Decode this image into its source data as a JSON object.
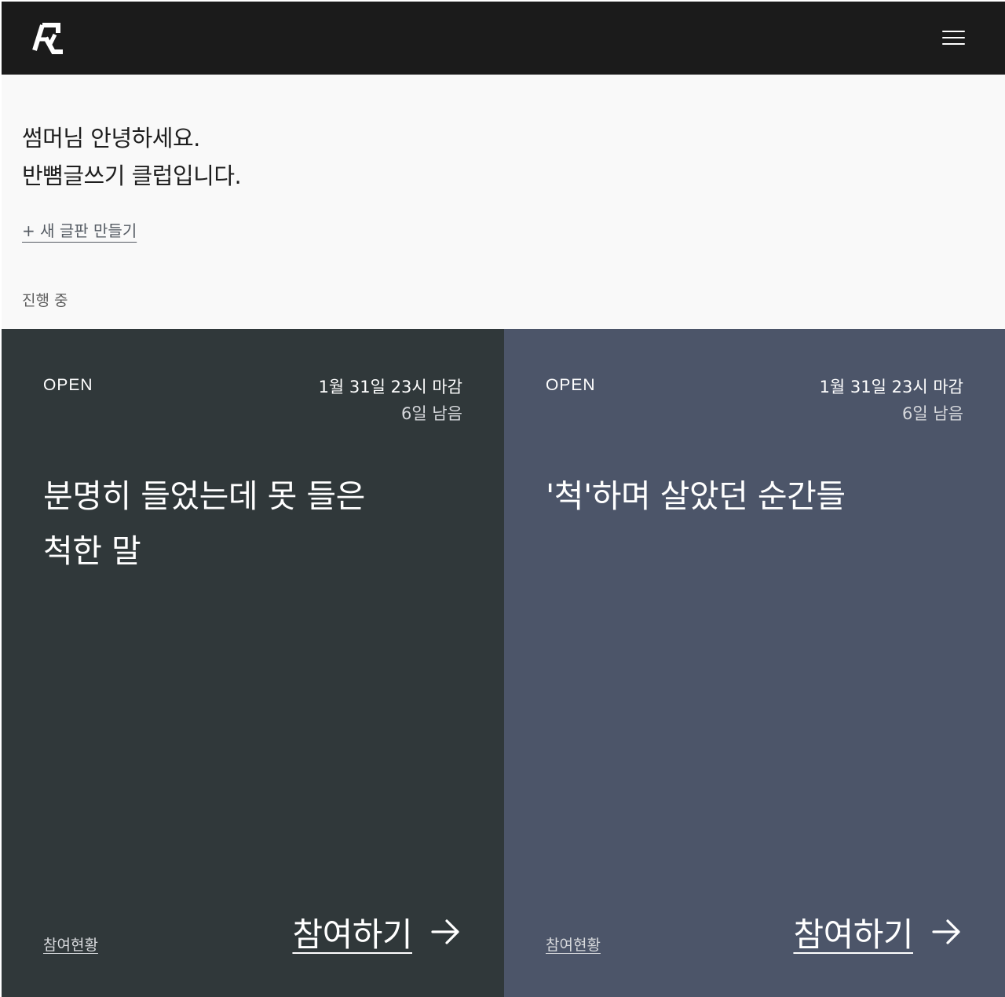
{
  "header": {
    "logo_icon": "brand-logo-icon",
    "menu_icon": "hamburger-menu-icon"
  },
  "greeting": {
    "line1": "썸머님 안녕하세요.",
    "line2": "반뼘글쓰기 클럽입니다."
  },
  "new_board_link": "+ 새 글판 만들기",
  "section_label": "진행 중",
  "cards": [
    {
      "status": "OPEN",
      "deadline": "1월 31일 23시 마감",
      "remaining": "6일 남음",
      "title_line1": "분명히 들었는데 못 들은",
      "title_line2": "척한 말",
      "participation_link": "참여현황",
      "join_label": "참여하기",
      "join_icon": "arrow-right-icon",
      "background": "#30383a"
    },
    {
      "status": "OPEN",
      "deadline": "1월 31일 23시 마감",
      "remaining": "6일 남음",
      "title_line1": "'척'하며 살았던 순간들",
      "title_line2": "",
      "participation_link": "참여현황",
      "join_label": "참여하기",
      "join_icon": "arrow-right-icon",
      "background": "#4c5569"
    }
  ]
}
